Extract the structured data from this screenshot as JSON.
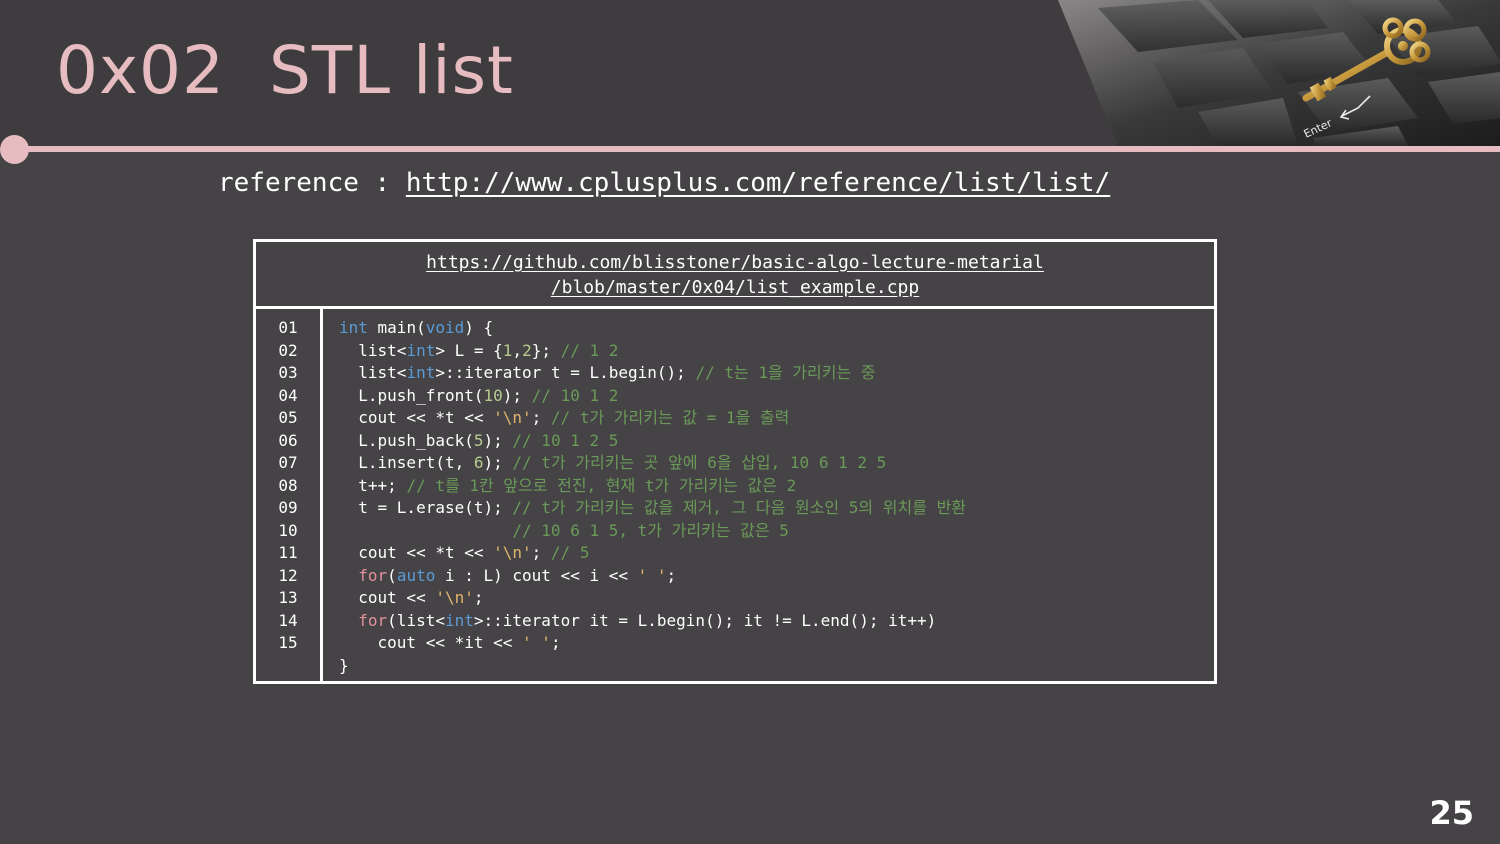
{
  "slide": {
    "title": "0x02  STL list",
    "page_number": "25"
  },
  "reference": {
    "label": "reference : ",
    "link": "http://www.cplusplus.com/reference/list/list/"
  },
  "code_box": {
    "header_line_1": "https://github.com/blisstoner/basic-algo-lecture-metarial",
    "header_line_2": "/blob/master/0x04/list_example.cpp",
    "line_numbers": [
      "01",
      "02",
      "03",
      "04",
      "05",
      "06",
      "07",
      "08",
      "09",
      "10",
      "11",
      "12",
      "13",
      "14",
      "15"
    ],
    "lines": [
      [
        {
          "t": "kw",
          "v": "int"
        },
        {
          "t": "plain",
          "v": " main("
        },
        {
          "t": "kw",
          "v": "void"
        },
        {
          "t": "plain",
          "v": ") {"
        }
      ],
      [
        {
          "t": "plain",
          "v": "  list<"
        },
        {
          "t": "kw",
          "v": "int"
        },
        {
          "t": "plain",
          "v": "> L = {"
        },
        {
          "t": "num",
          "v": "1"
        },
        {
          "t": "plain",
          "v": ","
        },
        {
          "t": "num",
          "v": "2"
        },
        {
          "t": "plain",
          "v": "}; "
        },
        {
          "t": "cmt",
          "v": "// 1 2"
        }
      ],
      [
        {
          "t": "plain",
          "v": "  list<"
        },
        {
          "t": "kw",
          "v": "int"
        },
        {
          "t": "plain",
          "v": ">::iterator t = L.begin(); "
        },
        {
          "t": "cmt",
          "v": "// t는 1을 가리키는 중"
        }
      ],
      [
        {
          "t": "plain",
          "v": "  L.push_front("
        },
        {
          "t": "num",
          "v": "10"
        },
        {
          "t": "plain",
          "v": "); "
        },
        {
          "t": "cmt",
          "v": "// 10 1 2"
        }
      ],
      [
        {
          "t": "plain",
          "v": "  cout << *t << "
        },
        {
          "t": "str",
          "v": "'\\n'"
        },
        {
          "t": "plain",
          "v": "; "
        },
        {
          "t": "cmt",
          "v": "// t가 가리키는 값 = 1을 출력"
        }
      ],
      [
        {
          "t": "plain",
          "v": "  L.push_back("
        },
        {
          "t": "num",
          "v": "5"
        },
        {
          "t": "plain",
          "v": "); "
        },
        {
          "t": "cmt",
          "v": "// 10 1 2 5"
        }
      ],
      [
        {
          "t": "plain",
          "v": "  L.insert(t, "
        },
        {
          "t": "num",
          "v": "6"
        },
        {
          "t": "plain",
          "v": "); "
        },
        {
          "t": "cmt",
          "v": "// t가 가리키는 곳 앞에 6을 삽입, 10 6 1 2 5"
        }
      ],
      [
        {
          "t": "plain",
          "v": "  t++; "
        },
        {
          "t": "cmt",
          "v": "// t를 1칸 앞으로 전진, 현재 t가 가리키는 값은 2"
        }
      ],
      [
        {
          "t": "plain",
          "v": "  t = L.erase(t); "
        },
        {
          "t": "cmt",
          "v": "// t가 가리키는 값을 제거, 그 다음 원소인 5의 위치를 반환"
        }
      ],
      [
        {
          "t": "plain",
          "v": "                  "
        },
        {
          "t": "cmt",
          "v": "// 10 6 1 5, t가 가리키는 값은 5"
        }
      ],
      [
        {
          "t": "plain",
          "v": "  cout << *t << "
        },
        {
          "t": "str",
          "v": "'\\n'"
        },
        {
          "t": "plain",
          "v": "; "
        },
        {
          "t": "cmt",
          "v": "// 5"
        }
      ],
      [
        {
          "t": "plain",
          "v": "  "
        },
        {
          "t": "ctl",
          "v": "for"
        },
        {
          "t": "plain",
          "v": "("
        },
        {
          "t": "kw",
          "v": "auto"
        },
        {
          "t": "plain",
          "v": " i : L) cout << i << "
        },
        {
          "t": "str",
          "v": "' '"
        },
        {
          "t": "plain",
          "v": ";"
        }
      ],
      [
        {
          "t": "plain",
          "v": "  cout << "
        },
        {
          "t": "str",
          "v": "'\\n'"
        },
        {
          "t": "plain",
          "v": ";"
        }
      ],
      [
        {
          "t": "plain",
          "v": "  "
        },
        {
          "t": "ctl",
          "v": "for"
        },
        {
          "t": "plain",
          "v": "(list<"
        },
        {
          "t": "kw",
          "v": "int"
        },
        {
          "t": "plain",
          "v": ">::iterator it = L.begin(); it != L.end(); it++)"
        }
      ],
      [
        {
          "t": "plain",
          "v": "    cout << *it << "
        },
        {
          "t": "str",
          "v": "' '"
        },
        {
          "t": "plain",
          "v": ";"
        }
      ],
      [
        {
          "t": "plain",
          "v": "}"
        }
      ]
    ]
  },
  "colors": {
    "background": "#454345",
    "title": "#e6bcc0",
    "accent": "#e6bcc0",
    "keyword": "#5b9bd5",
    "control_keyword": "#e1909c",
    "string": "#e1b46e",
    "number": "#b6cc8f",
    "comment": "#6a9a58"
  },
  "icons": [
    "key-icon",
    "enter-key-icon",
    "arrow-icon"
  ]
}
